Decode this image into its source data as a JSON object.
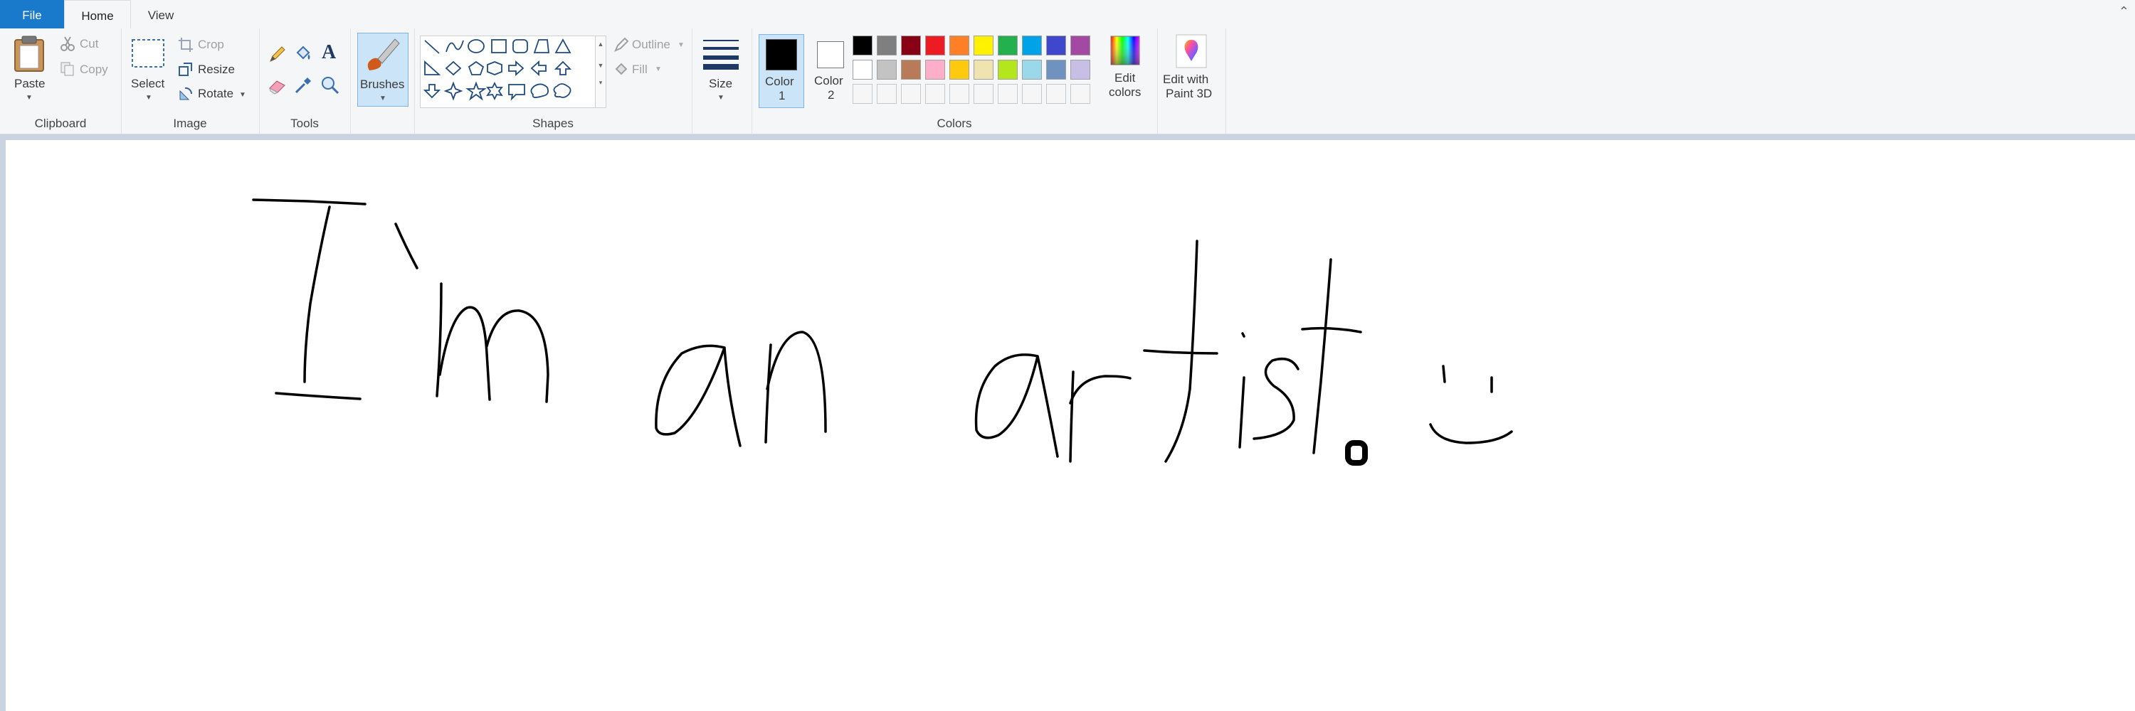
{
  "tabs": {
    "file": "File",
    "home": "Home",
    "view": "View"
  },
  "clipboard": {
    "paste": "Paste",
    "cut": "Cut",
    "copy": "Copy",
    "group": "Clipboard"
  },
  "image": {
    "select": "Select",
    "crop": "Crop",
    "resize": "Resize",
    "rotate": "Rotate",
    "group": "Image"
  },
  "tools": {
    "group": "Tools"
  },
  "brushes": {
    "label": "Brushes"
  },
  "shapes": {
    "outline": "Outline",
    "fill": "Fill",
    "group": "Shapes"
  },
  "size": {
    "label": "Size"
  },
  "colors": {
    "color1": "Color",
    "color1_num": "1",
    "color2": "Color",
    "color2_num": "2",
    "edit": "Edit",
    "edit2": "colors",
    "group": "Colors",
    "color1_value": "#000000",
    "color2_value": "#ffffff",
    "palette_row1": [
      "#000000",
      "#7f7f7f",
      "#880015",
      "#ed1c24",
      "#ff7f27",
      "#fff200",
      "#22b14c",
      "#00a2e8",
      "#3f48cc",
      "#a349a4"
    ],
    "palette_row2": [
      "#ffffff",
      "#c3c3c3",
      "#b97a57",
      "#ffaec9",
      "#ffc90e",
      "#efe4b0",
      "#b5e61d",
      "#99d9ea",
      "#7092be",
      "#c8bfe7"
    ]
  },
  "paint3d": {
    "line1": "Edit with",
    "line2": "Paint 3D"
  },
  "icons": [
    "paste-icon",
    "cut-icon",
    "copy-icon",
    "select-icon",
    "crop-icon",
    "resize-icon",
    "rotate-icon",
    "pencil-icon",
    "fill-icon",
    "text-icon",
    "eraser-icon",
    "color-picker-icon",
    "magnifier-icon",
    "brush-icon",
    "size-icon",
    "edit-colors-icon",
    "paint3d-icon"
  ],
  "canvas": {
    "drawing": "I'm an artist. :)"
  }
}
